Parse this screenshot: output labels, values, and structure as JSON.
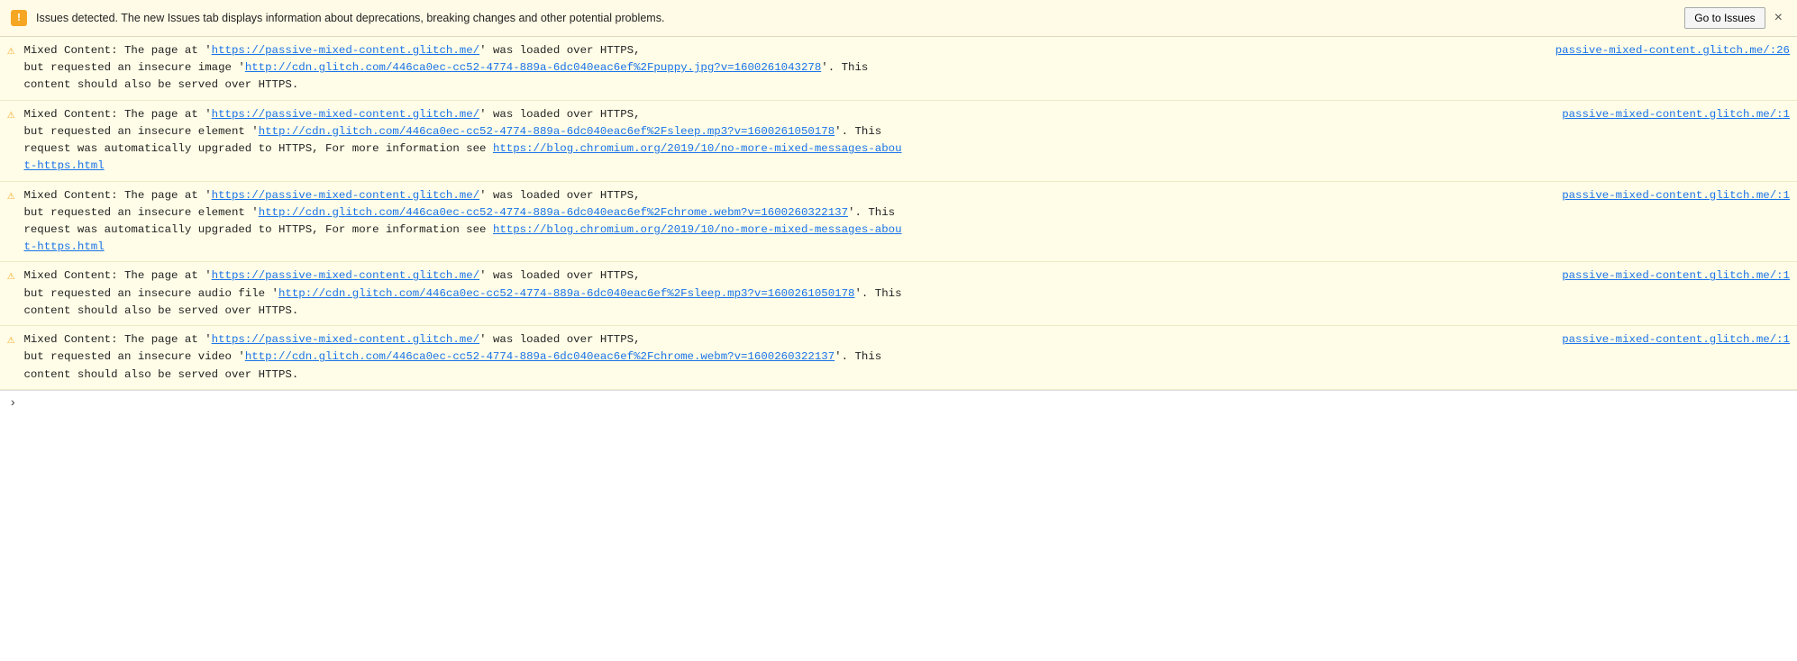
{
  "banner": {
    "icon": "!",
    "text": "Issues detected. The new Issues tab displays information about deprecations, breaking changes and other potential problems.",
    "button_label": "Go to Issues",
    "close_label": "×"
  },
  "messages": [
    {
      "id": 1,
      "source_link": "passive-mixed-content.glitch.me/:26",
      "line1_pre": "Mixed Content: The page at '",
      "page_url": "https://passive-mixed-content.glitch.me/",
      "line1_post": "' was loaded over HTTPS,",
      "line2_pre": "but requested an insecure image '",
      "resource_url": "http://cdn.glitch.com/446ca0ec-cc52-4774-889a-6dc040eac6ef%2Fpuppy.jpg?v=1600261043278",
      "line2_post": "'. This",
      "line3": "content should also be served over HTTPS.",
      "extra_link": null
    },
    {
      "id": 2,
      "source_link": "passive-mixed-content.glitch.me/:1",
      "line1_pre": "Mixed Content: The page at '",
      "page_url": "https://passive-mixed-content.glitch.me/",
      "line1_post": "' was loaded over HTTPS,",
      "line2_pre": "but requested an insecure element '",
      "resource_url": "http://cdn.glitch.com/446ca0ec-cc52-4774-889a-6dc040eac6ef%2Fsleep.mp3?v=1600261050178",
      "line2_post": "'. This",
      "line3": "request was automatically upgraded to HTTPS, For more information see",
      "extra_link": "https://blog.chromium.org/2019/10/no-more-mixed-messages-about-https.html",
      "extra_link_text": "https://blog.chromium.org/2019/10/no-more-mixed-messages-abou\nt-https.html"
    },
    {
      "id": 3,
      "source_link": "passive-mixed-content.glitch.me/:1",
      "line1_pre": "Mixed Content: The page at '",
      "page_url": "https://passive-mixed-content.glitch.me/",
      "line1_post": "' was loaded over HTTPS,",
      "line2_pre": "but requested an insecure element '",
      "resource_url": "http://cdn.glitch.com/446ca0ec-cc52-4774-889a-6dc040eac6ef%2Fchrome.webm?v=1600260322137",
      "line2_post": "'. This",
      "line3": "request was automatically upgraded to HTTPS, For more information see",
      "extra_link": "https://blog.chromium.org/2019/10/no-more-mixed-messages-about-https.html",
      "extra_link_text": "https://blog.chromium.org/2019/10/no-more-mixed-messages-abou\nt-https.html"
    },
    {
      "id": 4,
      "source_link": "passive-mixed-content.glitch.me/:1",
      "line1_pre": "Mixed Content: The page at '",
      "page_url": "https://passive-mixed-content.glitch.me/",
      "line1_post": "' was loaded over HTTPS,",
      "line2_pre": "but requested an insecure audio file '",
      "resource_url": "http://cdn.glitch.com/446ca0ec-cc52-4774-889a-6dc040eac6ef%2Fsleep.mp3?v=1600261050178",
      "line2_post": "'. This",
      "line3": "content should also be served over HTTPS.",
      "extra_link": null
    },
    {
      "id": 5,
      "source_link": "passive-mixed-content.glitch.me/:1",
      "line1_pre": "Mixed Content: The page at '",
      "page_url": "https://passive-mixed-content.glitch.me/",
      "line1_post": "' was loaded over HTTPS,",
      "line2_pre": "but requested an insecure video '",
      "resource_url": "http://cdn.glitch.com/446ca0ec-cc52-4774-889a-6dc040eac6ef%2Fchrome.webm?v=1600260322137",
      "line2_post": "'. This",
      "line3": "content should also be served over HTTPS.",
      "extra_link": null
    }
  ],
  "bottom": {
    "chevron": "›"
  }
}
